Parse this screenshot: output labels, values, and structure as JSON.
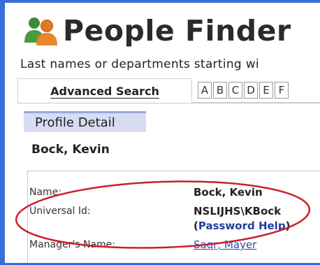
{
  "app": {
    "title": "People Finder"
  },
  "search": {
    "instructions": "Last names or departments starting wi"
  },
  "tabs": {
    "advanced_label": "Advanced Search",
    "letters": [
      "A",
      "B",
      "C",
      "D",
      "E",
      "F"
    ]
  },
  "profile": {
    "section_title": "Profile Detail",
    "person_name": "Bock, Kevin",
    "fields": {
      "name_label": "Name:",
      "name_value": "Bock, Kevin",
      "universal_id_label": "Universal Id:",
      "universal_id_value": "NSLIJHS\\KBock",
      "password_help_open": "(",
      "password_help_link": "Password Help",
      "password_help_close": ")",
      "manager_label": "Manager's Name:",
      "manager_value": "Saqr, Mayer"
    }
  },
  "annotation": {
    "color": "#c8202a"
  },
  "icons": {
    "app_icon": "people-icon"
  }
}
